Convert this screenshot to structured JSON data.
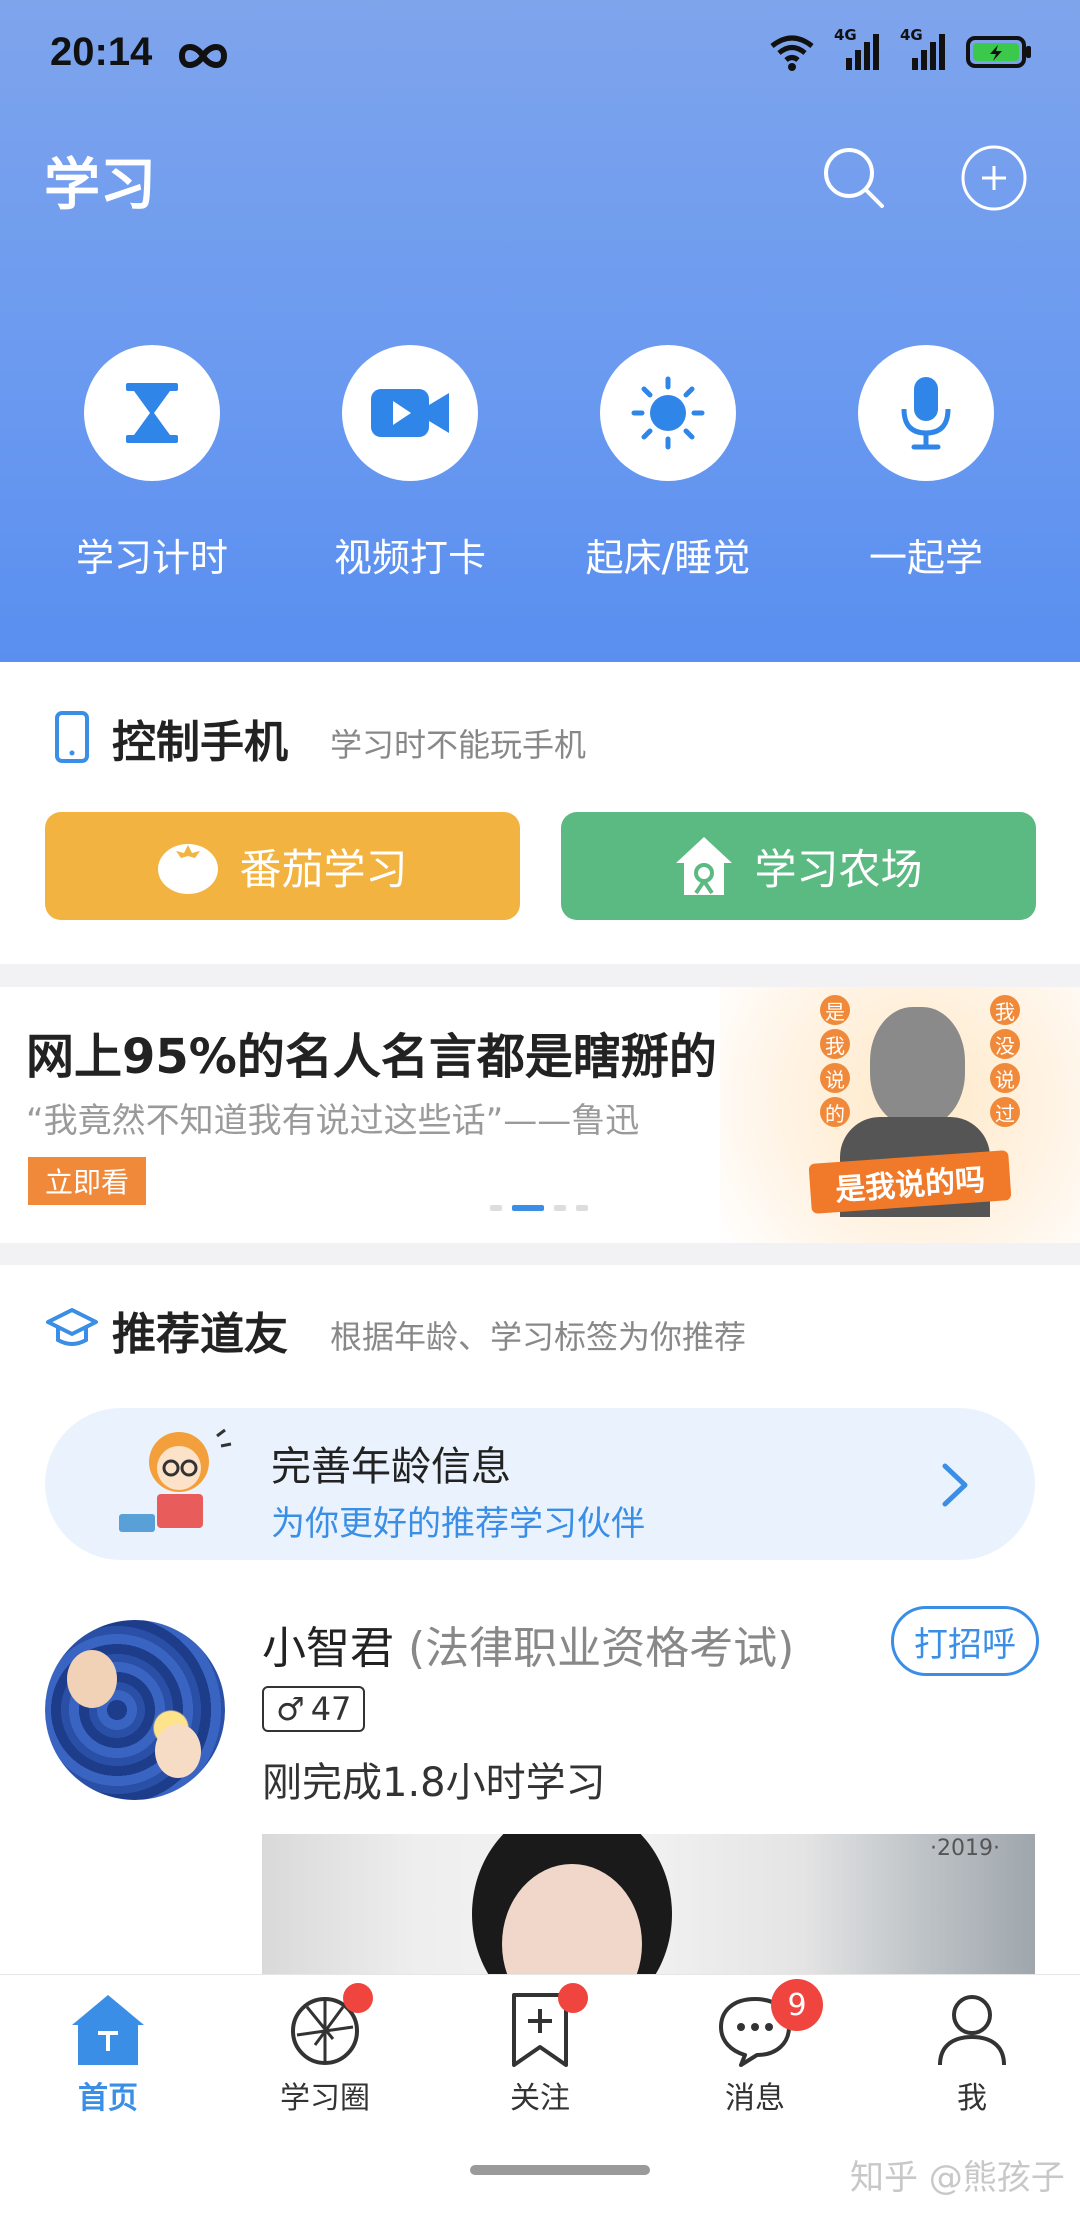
{
  "status_bar": {
    "time": "20:14",
    "signal_1": "4G",
    "signal_2": "4G"
  },
  "header": {
    "title": "学习"
  },
  "quick_actions": [
    {
      "label": "学习计时",
      "icon": "hourglass-icon"
    },
    {
      "label": "视频打卡",
      "icon": "video-camera-icon"
    },
    {
      "label": "起床/睡觉",
      "icon": "sun-icon"
    },
    {
      "label": "一起学",
      "icon": "microphone-icon"
    }
  ],
  "control_phone": {
    "title": "控制手机",
    "subtitle": "学习时不能玩手机",
    "tomato_label": "番茄学习",
    "farm_label": "学习农场"
  },
  "banner": {
    "title": "网上95%的名人名言都是瞎掰的",
    "subtitle": "“我竟然不知道我有说过这些话”——鲁迅",
    "cta": "立即看",
    "art_left": [
      "是",
      "我",
      "说",
      "的"
    ],
    "art_right": [
      "我",
      "没",
      "说",
      "过"
    ],
    "art_ribbon": "是我说的吗"
  },
  "recommend": {
    "title": "推荐道友",
    "subtitle": "根据年龄、学习标签为你推荐",
    "tip_title": "完善年龄信息",
    "tip_subtitle": "为你更好的推荐学习伙伴",
    "user": {
      "name": "小智君",
      "tag": "(法律职业资格考试)",
      "greet_button": "打招呼",
      "gender_symbol": "♂",
      "age": "47",
      "status": "刚完成1.8小时学习",
      "photo_year": "·2019·"
    }
  },
  "tabbar": [
    {
      "label": "首页",
      "active": true
    },
    {
      "label": "学习圈"
    },
    {
      "label": "关注"
    },
    {
      "label": "消息",
      "badge": "9"
    },
    {
      "label": "我"
    }
  ],
  "watermark": "知乎 @熊孩子",
  "colors": {
    "primary_blue": "#3a8ee6",
    "header_blue": "#6b9af0",
    "tomato_orange": "#f2b341",
    "farm_green": "#5bb982",
    "badge_red": "#f0443e"
  }
}
